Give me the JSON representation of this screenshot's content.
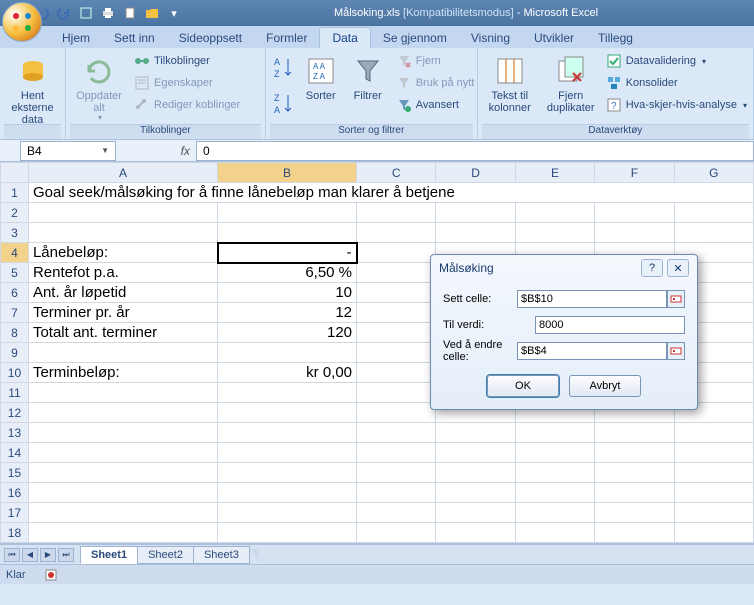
{
  "titlebar": {
    "doc": "Målsoking.xls",
    "mode": "[Kompatibilitetsmodus]",
    "app": "Microsoft Excel"
  },
  "tabs": {
    "items": [
      "Hjem",
      "Sett inn",
      "Sideoppsett",
      "Formler",
      "Data",
      "Se gjennom",
      "Visning",
      "Utvikler",
      "Tillegg"
    ],
    "activeIndex": 4
  },
  "ribbon": {
    "g0": {
      "label": "",
      "btn0": "Hent eksterne\ndata"
    },
    "g1": {
      "label": "Tilkoblinger",
      "btn0": "Oppdater\nalt",
      "r0": "Tilkoblinger",
      "r1": "Egenskaper",
      "r2": "Rediger koblinger"
    },
    "g2": {
      "label": "Sorter og filtrer",
      "sort": "Sorter",
      "filter": "Filtrer",
      "r0": "Fjern",
      "r1": "Bruk på nytt",
      "r2": "Avansert"
    },
    "g3": {
      "label": "Dataverktøy",
      "b0": "Tekst til\nkolonner",
      "b1": "Fjern\nduplikater",
      "r0": "Datavalidering",
      "r1": "Konsolider",
      "r2": "Hva-skjer-hvis-analyse"
    }
  },
  "formulaBar": {
    "name": "B4",
    "fx": "fx",
    "value": "0"
  },
  "columns": [
    "A",
    "B",
    "C",
    "D",
    "E",
    "F",
    "G"
  ],
  "rows": [
    {
      "n": "1",
      "a": "Goal seek/målsøking for å finne lånebeløp man klarer å betjene",
      "b": "",
      "span": true
    },
    {
      "n": "2"
    },
    {
      "n": "3"
    },
    {
      "n": "4",
      "a": "Lånebeløp:",
      "b": "-",
      "sel": true
    },
    {
      "n": "5",
      "a": "Rentefot p.a.",
      "b": "6,50 %"
    },
    {
      "n": "6",
      "a": "Ant. år løpetid",
      "b": "10"
    },
    {
      "n": "7",
      "a": "Terminer pr. år",
      "b": "12"
    },
    {
      "n": "8",
      "a": "Totalt ant. terminer",
      "b": "120"
    },
    {
      "n": "9"
    },
    {
      "n": "10",
      "a": "Terminbeløp:",
      "b": "kr 0,00"
    },
    {
      "n": "11"
    },
    {
      "n": "12"
    },
    {
      "n": "13"
    },
    {
      "n": "14"
    },
    {
      "n": "15"
    },
    {
      "n": "16"
    },
    {
      "n": "17"
    },
    {
      "n": "18"
    }
  ],
  "sheets": {
    "items": [
      "Sheet1",
      "Sheet2",
      "Sheet3"
    ],
    "activeIndex": 0
  },
  "status": {
    "text": "Klar"
  },
  "dialog": {
    "title": "Målsøking",
    "row0": {
      "label": "Sett celle:",
      "value": "$B$10"
    },
    "row1": {
      "label": "Til verdi:",
      "value": "8000"
    },
    "row2": {
      "label": "Ved å endre celle:",
      "value": "$B$4"
    },
    "ok": "OK",
    "cancel": "Avbryt"
  }
}
